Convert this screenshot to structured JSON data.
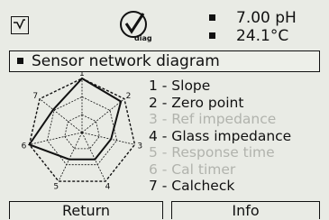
{
  "header": {
    "device_icon": "sensor-arrow-icon",
    "diag_icon": "checkmark-diag-icon",
    "diag_label": "diag",
    "readings": [
      "7.00 pH",
      "24.1°C"
    ]
  },
  "sensor_box": {
    "label": "Sensor network diagram"
  },
  "diagram": {
    "axis_labels": [
      "1",
      "2",
      "3",
      "4",
      "5",
      "6",
      "7"
    ],
    "values": [
      1.0,
      0.92,
      0.55,
      0.55,
      0.55,
      1.0,
      0.68
    ]
  },
  "items": [
    {
      "label": "1 - Slope",
      "active": true
    },
    {
      "label": "2 - Zero point",
      "active": true
    },
    {
      "label": "3 - Ref impedance",
      "active": false
    },
    {
      "label": "4 - Glass impedance",
      "active": true
    },
    {
      "label": "5 - Response time",
      "active": false
    },
    {
      "label": "6 - Cal timer",
      "active": false
    },
    {
      "label": "7 - Calcheck",
      "active": true
    }
  ],
  "buttons": {
    "return": "Return",
    "info": "Info"
  }
}
